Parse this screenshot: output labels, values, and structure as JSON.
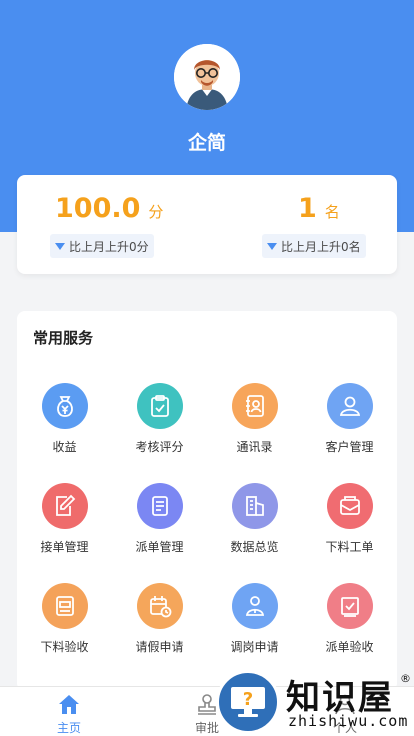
{
  "profile": {
    "name": "企简"
  },
  "score": {
    "value": "100.0",
    "unit": "分",
    "trend": "比上月上升0分"
  },
  "rank": {
    "value": "1",
    "unit": "名",
    "trend": "比上月上升0名"
  },
  "services": {
    "title": "常用服务",
    "items": [
      {
        "label": "收益",
        "icon": "money-bag-icon",
        "color": "#5b9cf2"
      },
      {
        "label": "考核评分",
        "icon": "clipboard-check-icon",
        "color": "#3fc2c0"
      },
      {
        "label": "通讯录",
        "icon": "contact-book-icon",
        "color": "#f7a55a"
      },
      {
        "label": "客户管理",
        "icon": "customer-icon",
        "color": "#6fa4f3"
      },
      {
        "label": "接单管理",
        "icon": "edit-document-icon",
        "color": "#ef6b6b"
      },
      {
        "label": "派单管理",
        "icon": "document-list-icon",
        "color": "#7b87f3"
      },
      {
        "label": "数据总览",
        "icon": "buildings-icon",
        "color": "#8f97e8"
      },
      {
        "label": "下料工单",
        "icon": "envelope-icon",
        "color": "#f06c71"
      },
      {
        "label": "下料验收",
        "icon": "inspection-icon",
        "color": "#f4a25a"
      },
      {
        "label": "请假申请",
        "icon": "calendar-clock-icon",
        "color": "#f5a65b"
      },
      {
        "label": "调岗申请",
        "icon": "person-transfer-icon",
        "color": "#6fa4f3"
      },
      {
        "label": "派单验收",
        "icon": "checkbox-icon",
        "color": "#f07e87"
      }
    ]
  },
  "tabbar": {
    "tabs": [
      {
        "label": "主页",
        "icon": "home-icon",
        "active": true
      },
      {
        "label": "审批",
        "icon": "stamp-icon",
        "active": false
      },
      {
        "label": "个人",
        "icon": "person-icon",
        "active": false
      }
    ]
  },
  "watermark": {
    "brand": "知识屋",
    "reg": "®",
    "domain": "zhishiwu.com",
    "glyph": "?"
  },
  "colors": {
    "primary": "#4a8ef0",
    "accent": "#f5a11c",
    "background": "#f3f4f6"
  }
}
